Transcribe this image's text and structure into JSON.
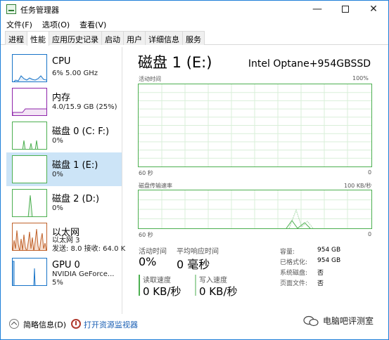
{
  "window": {
    "title": "任务管理器",
    "menu": [
      "文件(F)",
      "选项(O)",
      "查看(V)"
    ],
    "tabs": [
      "进程",
      "性能",
      "应用历史记录",
      "启动",
      "用户",
      "详细信息",
      "服务"
    ],
    "active_tab": 1
  },
  "sidebar": {
    "items": [
      {
        "title": "CPU",
        "line1": "6% 5.00 GHz",
        "line2": ""
      },
      {
        "title": "内存",
        "line1": "4.0/15.9 GB (25%)",
        "line2": ""
      },
      {
        "title": "磁盘 0 (C: F:)",
        "line1": "0%",
        "line2": ""
      },
      {
        "title": "磁盘 1 (E:)",
        "line1": "0%",
        "line2": ""
      },
      {
        "title": "磁盘 2 (D:)",
        "line1": "0%",
        "line2": ""
      },
      {
        "title": "以太网",
        "line1": "以太网 3",
        "line2": "发送: 8.0 接收: 64.0 K"
      },
      {
        "title": "GPU 0",
        "line1": "NVIDIA GeForce...",
        "line2": "5%"
      }
    ],
    "selected_index": 3
  },
  "main": {
    "title": "磁盘 1 (E:)",
    "device": "Intel Optane+954GBSSD",
    "graph1": {
      "label": "活动时间",
      "max": "100%",
      "x_left": "60 秒",
      "x_right": "0"
    },
    "graph2": {
      "label": "磁盘传输速率",
      "max": "100 KB/秒",
      "x_left": "60 秒",
      "x_right": "0"
    },
    "stats": {
      "active_label": "活动时间",
      "active_value": "0%",
      "resp_label": "平均响应时间",
      "resp_value": "0 毫秒",
      "read_label": "读取速度",
      "read_value": "0 KB/秒",
      "write_label": "写入速度",
      "write_value": "0 KB/秒"
    },
    "details": [
      {
        "label": "容量:",
        "value": "954 GB"
      },
      {
        "label": "已格式化:",
        "value": "954 GB"
      },
      {
        "label": "系统磁盘:",
        "value": "否"
      },
      {
        "label": "页面文件:",
        "value": "否"
      }
    ]
  },
  "footer": {
    "summary": "简略信息(D)",
    "monitor": "打开资源监视器"
  },
  "watermark": "电脑吧评测室",
  "colors": {
    "disk_green": "#4caf50",
    "cpu_blue": "#1874c8",
    "mem_purple": "#8e24aa",
    "net_orange": "#c0622b",
    "selected_bg": "#cce4f7"
  },
  "icons": [
    "task-manager-icon",
    "minimize-icon",
    "maximize-icon",
    "close-icon",
    "collapse-icon",
    "resource-monitor-icon",
    "wechat-icon"
  ]
}
